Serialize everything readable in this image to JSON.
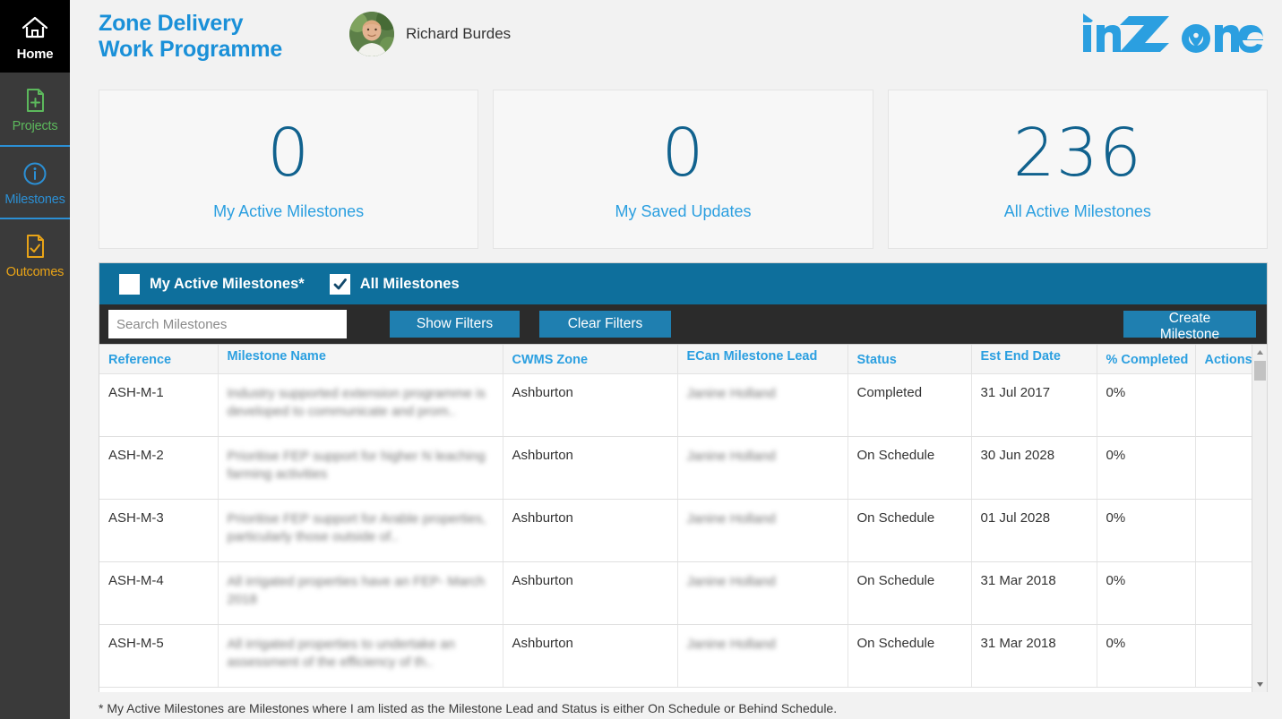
{
  "sidebar": {
    "items": [
      {
        "label": "Home",
        "icon": "home-icon",
        "name": "sidebar-item-home"
      },
      {
        "label": "Projects",
        "icon": "document-plus-icon",
        "name": "sidebar-item-projects"
      },
      {
        "label": "Milestones",
        "icon": "info-circle-icon",
        "name": "sidebar-item-milestones"
      },
      {
        "label": "Outcomes",
        "icon": "document-check-icon",
        "name": "sidebar-item-outcomes"
      }
    ]
  },
  "header": {
    "title_line1": "Zone Delivery",
    "title_line2": "Work Programme",
    "user_name": "Richard Burdes",
    "logo_text": "inZone"
  },
  "cards": [
    {
      "value": "0",
      "label": "My Active Milestones"
    },
    {
      "value": "0",
      "label": "My Saved Updates"
    },
    {
      "value": "236",
      "label": "All Active Milestones"
    }
  ],
  "filters": {
    "my_active_label": "My Active Milestones*",
    "my_active_checked": false,
    "all_label": "All Milestones",
    "all_checked": true,
    "search_placeholder": "Search Milestones",
    "search_value": "",
    "show_filters_label": "Show Filters",
    "clear_filters_label": "Clear Filters",
    "create_label": "Create Milestone"
  },
  "table": {
    "columns": [
      "Reference",
      "Milestone Name",
      "CWMS Zone",
      "ECan Milestone Lead",
      "Status",
      "Est End Date",
      "% Completed",
      "Actions"
    ],
    "rows": [
      {
        "reference": "ASH-M-1",
        "milestone_name": "Industry supported extension programme is developed to communicate and prom..",
        "cwms_zone": "Ashburton",
        "ecan_lead": "Janine Holland",
        "status": "Completed",
        "est_end_date": "31 Jul 2017",
        "percent_completed": "0%",
        "actions": ""
      },
      {
        "reference": "ASH-M-2",
        "milestone_name": "Prioritise FEP support for higher N leaching farming activities",
        "cwms_zone": "Ashburton",
        "ecan_lead": "Janine Holland",
        "status": "On Schedule",
        "est_end_date": "30 Jun 2028",
        "percent_completed": "0%",
        "actions": ""
      },
      {
        "reference": "ASH-M-3",
        "milestone_name": "Prioritise FEP support for Arable properties, particularly those outside of..",
        "cwms_zone": "Ashburton",
        "ecan_lead": "Janine Holland",
        "status": "On Schedule",
        "est_end_date": "01 Jul 2028",
        "percent_completed": "0%",
        "actions": ""
      },
      {
        "reference": "ASH-M-4",
        "milestone_name": "All irrigated properties have an FEP- March 2018",
        "cwms_zone": "Ashburton",
        "ecan_lead": "Janine Holland",
        "status": "On Schedule",
        "est_end_date": "31 Mar 2018",
        "percent_completed": "0%",
        "actions": ""
      },
      {
        "reference": "ASH-M-5",
        "milestone_name": "All irrigated properties to undertake an assessment of the efficiency of th..",
        "cwms_zone": "Ashburton",
        "ecan_lead": "Janine Holland",
        "status": "On Schedule",
        "est_end_date": "31 Mar 2018",
        "percent_completed": "0%",
        "actions": ""
      }
    ]
  },
  "footnote": "* My Active Milestones are Milestones where I am listed as the Milestone Lead and Status is either On Schedule or Behind Schedule.",
  "colors": {
    "brand_blue": "#2b9fe0",
    "panel_teal": "#0e6f9c",
    "button_blue": "#1f7fb0",
    "sidebar_dark": "#3a3a3a",
    "projects_green": "#5cb85c",
    "outcomes_amber": "#e8a317",
    "card_number": "#11628e"
  }
}
